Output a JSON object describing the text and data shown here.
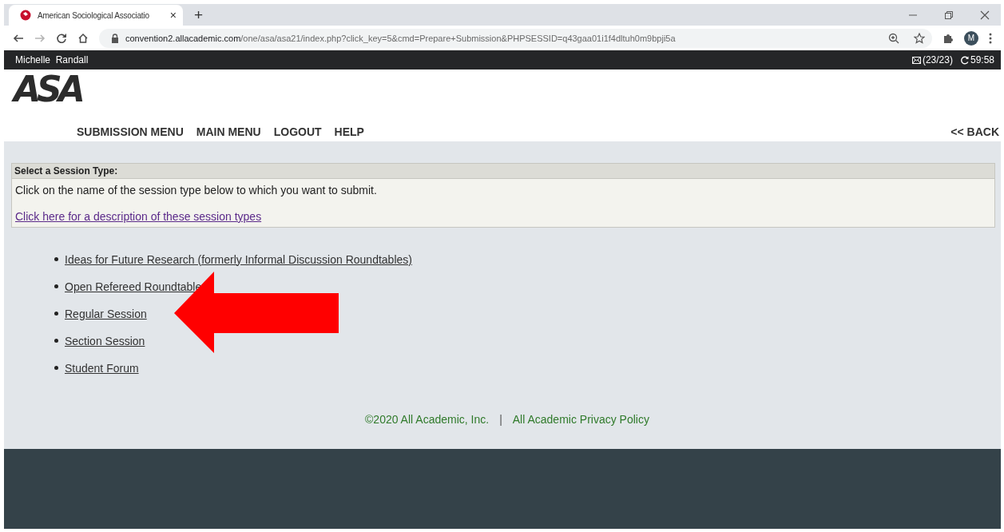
{
  "browser": {
    "tab": {
      "title": "American Sociological Associatio",
      "close": "×"
    },
    "new_tab": "+",
    "nav_buttons": [
      {
        "kind": "back",
        "disabled": false
      },
      {
        "kind": "forward",
        "disabled": true
      },
      {
        "kind": "reload",
        "disabled": false
      },
      {
        "kind": "home",
        "disabled": false
      }
    ],
    "url": {
      "host": "convention2.allacademic.com",
      "path": "/one/asa/asa21/index.php?click_key=5&cmd=Prepare+Submission&PHPSESSID=q43gaa01i1f4dltuh0m9bpji5a"
    },
    "avatar": "M"
  },
  "user_bar": {
    "user": "Michelle  Randall",
    "messages": "(23/23)",
    "timer": "59:58"
  },
  "logo": "ASA",
  "nav": [
    "SUBMISSION MENU",
    "MAIN MENU",
    "LOGOUT",
    "HELP"
  ],
  "back": "<< BACK",
  "panel": {
    "title": "Select a Session Type:",
    "instruction": "Click on the name of the session type below to which you want to submit.",
    "link": "Click here for a description of these session types"
  },
  "session_types": [
    {
      "label": "Ideas for Future Research (formerly Informal Discussion Roundtables)"
    },
    {
      "label": "Open Refereed Roundtable"
    },
    {
      "label": "Regular Session"
    },
    {
      "label": "Section Session"
    },
    {
      "label": "Student Forum"
    }
  ],
  "footer": {
    "copyright": "©2020 All Academic, Inc.",
    "separator": "|",
    "privacy": "All Academic Privacy Policy"
  }
}
